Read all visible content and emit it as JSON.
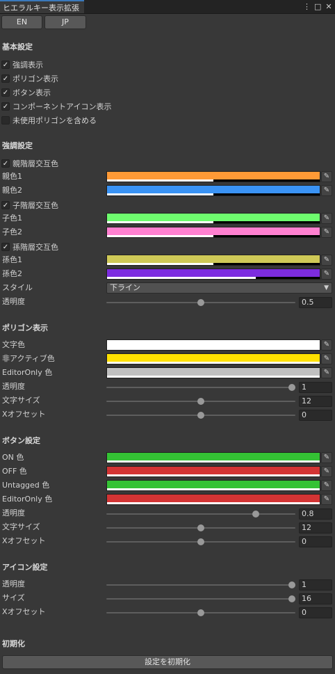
{
  "window": {
    "tab_title": "ヒエラルキー表示拡張",
    "menu_icon": "⋮",
    "maximize_icon": "□",
    "close_icon": "✕"
  },
  "lang": {
    "en": "EN",
    "jp": "JP"
  },
  "basic": {
    "title": "基本設定",
    "items": [
      {
        "label": "強調表示",
        "checked": true
      },
      {
        "label": "ポリゴン表示",
        "checked": true
      },
      {
        "label": "ボタン表示",
        "checked": true
      },
      {
        "label": "コンポーネントアイコン表示",
        "checked": true
      },
      {
        "label": "未使用ポリゴンを含める",
        "checked": false
      }
    ]
  },
  "highlight": {
    "title": "強調設定",
    "parent_toggle": "親階層交互色",
    "parent1": {
      "label": "親色1",
      "color": "#ff9a36",
      "alpha": 0.5
    },
    "parent2": {
      "label": "親色2",
      "color": "#3a93f5",
      "alpha": 0.5
    },
    "child_toggle": "子階層交互色",
    "child1": {
      "label": "子色1",
      "color": "#6efc6e",
      "alpha": 0.5
    },
    "child2": {
      "label": "子色2",
      "color": "#ff80d0",
      "alpha": 0.5
    },
    "grand_toggle": "孫階層交互色",
    "grand1": {
      "label": "孫色1",
      "color": "#cfc957",
      "alpha": 0.5
    },
    "grand2": {
      "label": "孫色2",
      "color": "#7c2ce0",
      "alpha": 0.7
    },
    "style_label": "スタイル",
    "style_value": "下ライン",
    "opacity_label": "透明度",
    "opacity_value": "0.5",
    "opacity_fraction": 0.5
  },
  "polygon": {
    "title": "ポリゴン表示",
    "text_color": {
      "label": "文字色",
      "color": "#ffffff",
      "alpha": 1.0
    },
    "inactive_color": {
      "label": "非アクティブ色",
      "color": "#ffe100",
      "alpha": 1.0
    },
    "editor_color": {
      "label": "EditorOnly 色",
      "color": "#c0c0c0",
      "alpha": 1.0
    },
    "opacity_label": "透明度",
    "opacity_value": "1",
    "opacity_fraction": 1.0,
    "size_label": "文字サイズ",
    "size_value": "12",
    "size_fraction": 0.5,
    "offset_label": "Xオフセット",
    "offset_value": "0",
    "offset_fraction": 0.5
  },
  "button": {
    "title": "ボタン設定",
    "on_color": {
      "label": "ON 色",
      "color": "#34c234",
      "alpha": 1.0
    },
    "off_color": {
      "label": "OFF 色",
      "color": "#d33434",
      "alpha": 1.0
    },
    "untagged_color": {
      "label": "Untagged 色",
      "color": "#34c234",
      "alpha": 1.0
    },
    "editor_color": {
      "label": "EditorOnly 色",
      "color": "#d33434",
      "alpha": 1.0
    },
    "opacity_label": "透明度",
    "opacity_value": "0.8",
    "opacity_fraction": 0.8,
    "size_label": "文字サイズ",
    "size_value": "12",
    "size_fraction": 0.5,
    "offset_label": "Xオフセット",
    "offset_value": "0",
    "offset_fraction": 0.5
  },
  "icon": {
    "title": "アイコン設定",
    "opacity_label": "透明度",
    "opacity_value": "1",
    "opacity_fraction": 1.0,
    "size_label": "サイズ",
    "size_value": "16",
    "size_fraction": 1.0,
    "offset_label": "Xオフセット",
    "offset_value": "0",
    "offset_fraction": 0.5
  },
  "init": {
    "title": "初期化",
    "reset_label": "設定を初期化"
  },
  "icons": {
    "check": "✓",
    "picker": "eyedropper-icon",
    "dropdown": "▼"
  }
}
